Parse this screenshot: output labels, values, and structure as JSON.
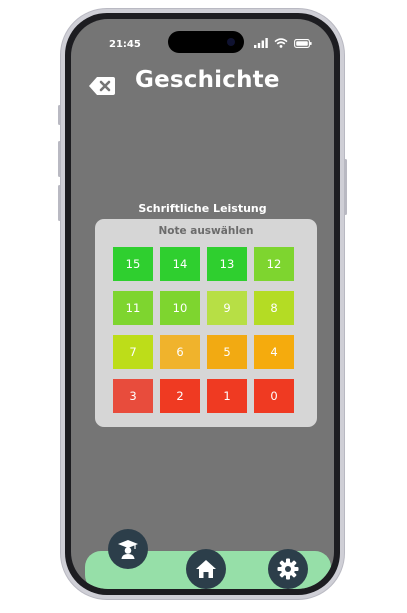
{
  "status_bar": {
    "time": "21:45"
  },
  "header": {
    "title": "Geschichte",
    "back_icon": "backspace-icon"
  },
  "section": {
    "label": "Schriftliche Leistung"
  },
  "grade_picker": {
    "title": "Note auswählen",
    "grades": [
      {
        "value": "15",
        "color": "#2fcf2f"
      },
      {
        "value": "14",
        "color": "#2fcf2f"
      },
      {
        "value": "13",
        "color": "#2fcf2f"
      },
      {
        "value": "12",
        "color": "#7ed52f"
      },
      {
        "value": "11",
        "color": "#7ed52f"
      },
      {
        "value": "10",
        "color": "#7ed52f"
      },
      {
        "value": "9",
        "color": "#b7df45"
      },
      {
        "value": "8",
        "color": "#b4dc24"
      },
      {
        "value": "7",
        "color": "#bddd19"
      },
      {
        "value": "6",
        "color": "#f0b32c"
      },
      {
        "value": "5",
        "color": "#f2aa12"
      },
      {
        "value": "4",
        "color": "#f5ab0d"
      },
      {
        "value": "3",
        "color": "#e84c3c"
      },
      {
        "value": "2",
        "color": "#ef3a22"
      },
      {
        "value": "1",
        "color": "#ef3a22"
      },
      {
        "value": "0",
        "color": "#ef3a22"
      }
    ]
  },
  "bottom_nav": {
    "background": "#96dfa8",
    "items": [
      {
        "icon": "graduation-cap-icon"
      },
      {
        "icon": "home-icon"
      },
      {
        "icon": "gear-icon"
      }
    ]
  }
}
